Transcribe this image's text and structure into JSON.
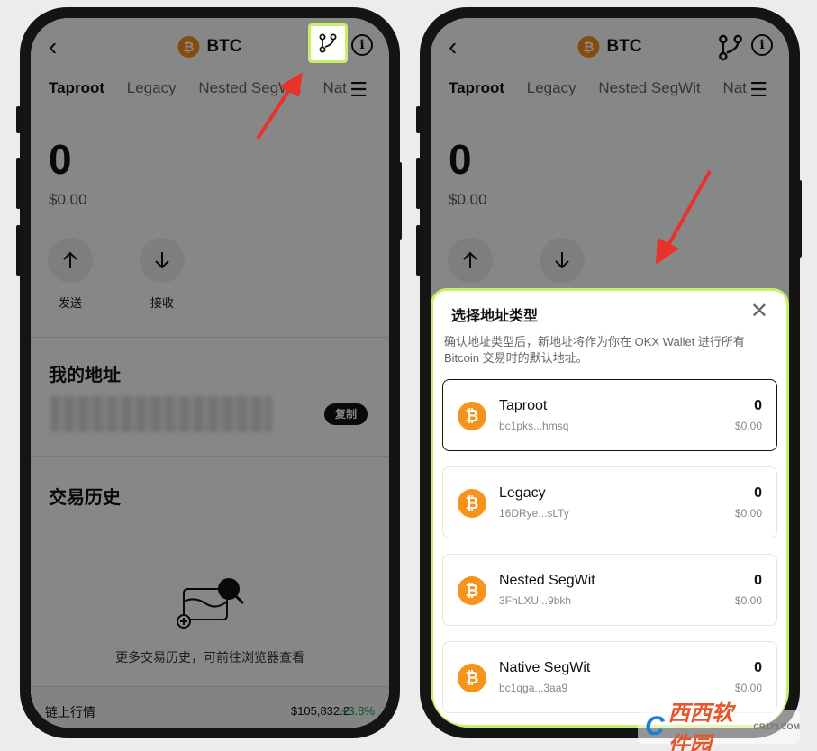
{
  "left": {
    "header": {
      "coin_symbol": "₿",
      "title": "BTC"
    },
    "tabs": [
      "Taproot",
      "Legacy",
      "Nested SegWit",
      "Nat"
    ],
    "balance": "0",
    "fiat": "$0.00",
    "actions": [
      {
        "label": "发送",
        "icon": "arrow-up-icon"
      },
      {
        "label": "接收",
        "icon": "arrow-down-icon"
      }
    ],
    "my_address_title": "我的地址",
    "copy_label": "复制",
    "history_title": "交易历史",
    "history_empty": "更多交易历史，可前往浏览器查看",
    "footer": {
      "label": "链上行情",
      "price": "$105,832.2",
      "change": "+3.8%"
    }
  },
  "right": {
    "header": {
      "coin_symbol": "₿",
      "title": "BTC"
    },
    "tabs": [
      "Taproot",
      "Legacy",
      "Nested SegWit",
      "Nat"
    ],
    "balance": "0",
    "fiat": "$0.00",
    "sheet": {
      "title": "选择地址类型",
      "description": "确认地址类型后，新地址将作为你在 OKX Wallet 进行所有 Bitcoin 交易时的默认地址。",
      "options": [
        {
          "name": "Taproot",
          "address": "bc1pks...hmsq",
          "amount": "0",
          "fiat": "$0.00",
          "selected": true
        },
        {
          "name": "Legacy",
          "address": "16DRye...sLTy",
          "amount": "0",
          "fiat": "$0.00",
          "selected": false
        },
        {
          "name": "Nested SegWit",
          "address": "3FhLXU...9bkh",
          "amount": "0",
          "fiat": "$0.00",
          "selected": false
        },
        {
          "name": "Native SegWit",
          "address": "bc1qga...3aa9",
          "amount": "0",
          "fiat": "$0.00",
          "selected": false
        }
      ]
    }
  },
  "watermark": {
    "brand": "西西软件园",
    "site": "CR173.COM",
    "letter": "C"
  },
  "colors": {
    "btc": "#f7931a",
    "highlight": "#c6f06a",
    "arrow": "#e8322b",
    "positive": "#1a9e3a"
  }
}
